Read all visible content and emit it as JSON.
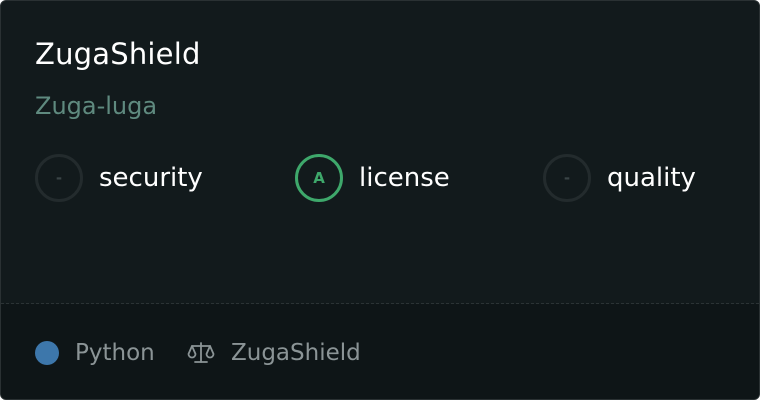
{
  "repo": {
    "name": "ZugaShield",
    "owner": "Zuga-luga"
  },
  "metrics": [
    {
      "grade": "-",
      "label": "security",
      "status": "none"
    },
    {
      "grade": "A",
      "label": "license",
      "status": "good"
    },
    {
      "grade": "-",
      "label": "quality",
      "status": "none"
    }
  ],
  "footer": {
    "language": "Python",
    "language_color": "#3d77ab",
    "license_icon": "scale-icon",
    "license": "ZugaShield"
  }
}
